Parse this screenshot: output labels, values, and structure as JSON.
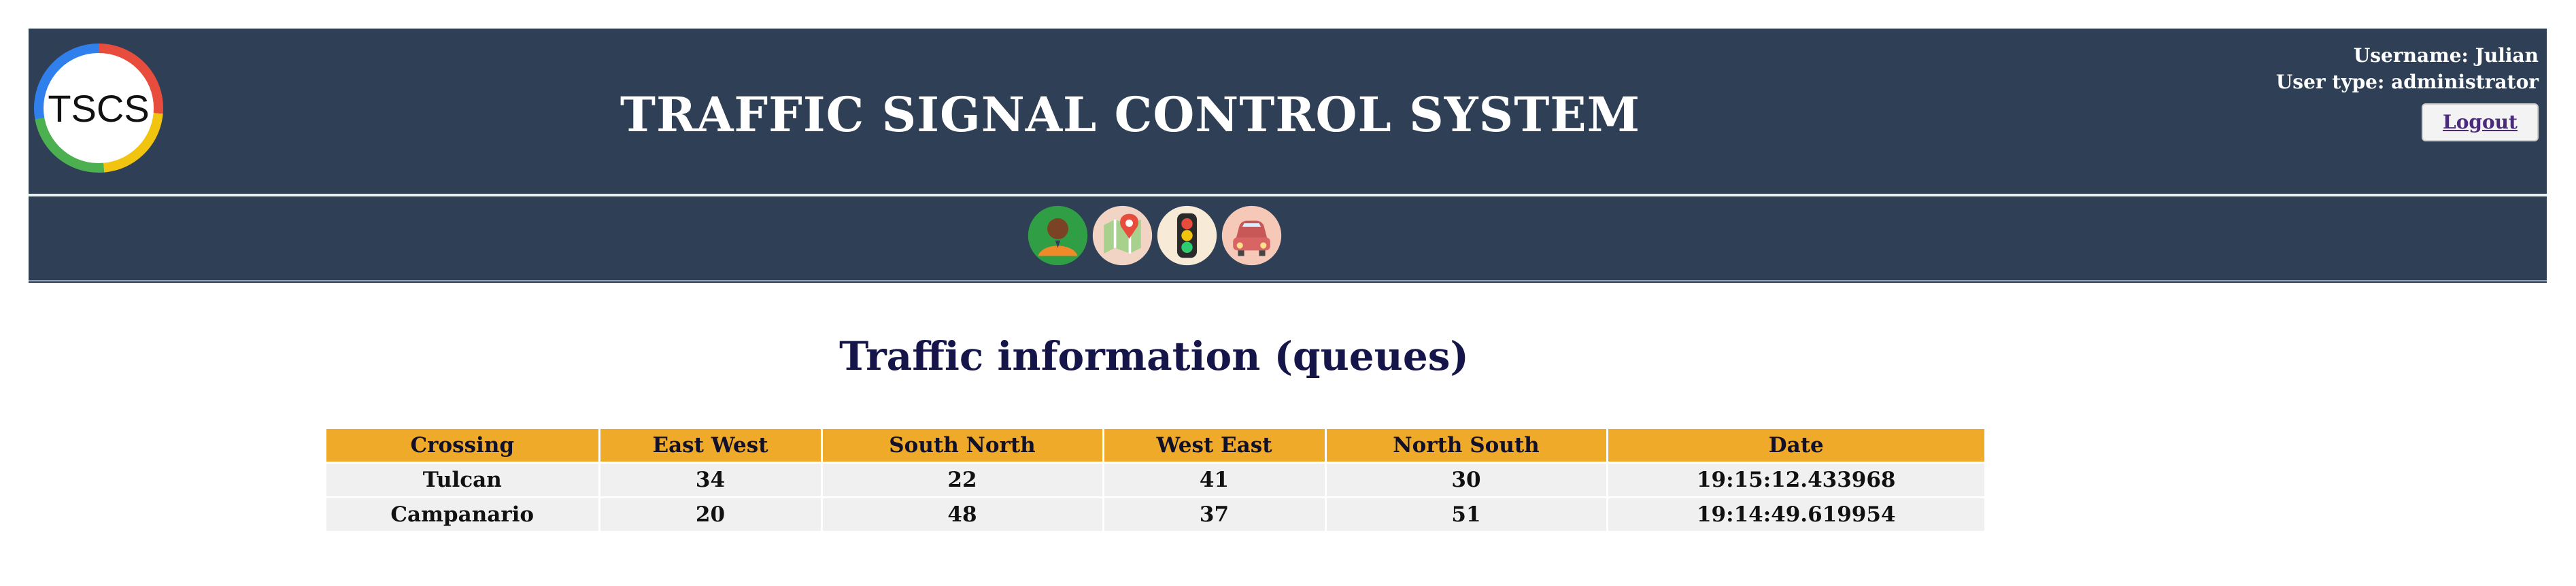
{
  "header": {
    "logo_text": "TSCS",
    "title": "TRAFFIC SIGNAL CONTROL SYSTEM",
    "username_label": "Username: Julian",
    "usertype_label": "User type: administrator",
    "logout_label": "Logout"
  },
  "nav": {
    "items": [
      {
        "name": "user-icon"
      },
      {
        "name": "map-pin-icon"
      },
      {
        "name": "traffic-light-icon"
      },
      {
        "name": "car-icon"
      }
    ]
  },
  "main": {
    "title": "Traffic information (queues)",
    "table": {
      "columns": [
        "Crossing",
        "East West",
        "South North",
        "West East",
        "North South",
        "Date"
      ],
      "rows": [
        [
          "Tulcan",
          "34",
          "22",
          "41",
          "30",
          "19:15:12.433968"
        ],
        [
          "Campanario",
          "20",
          "48",
          "37",
          "51",
          "19:14:49.619954"
        ]
      ]
    }
  }
}
